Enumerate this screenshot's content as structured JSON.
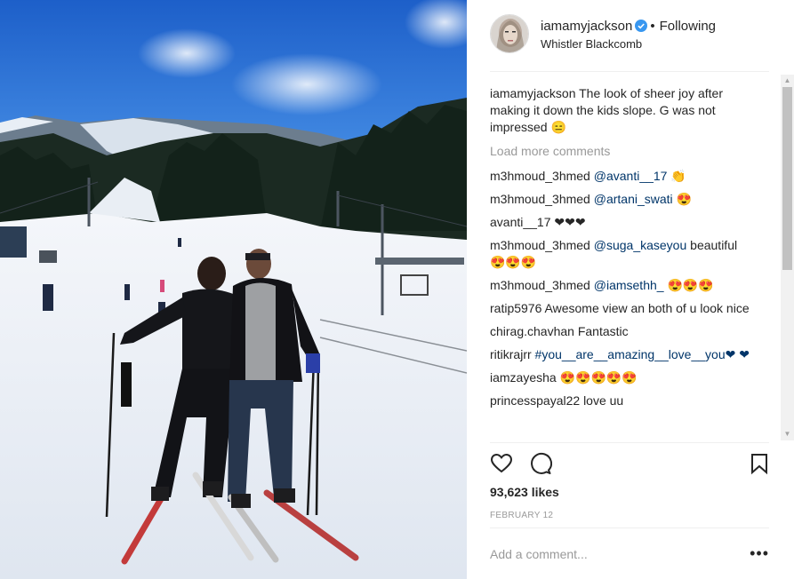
{
  "post": {
    "username": "iamamyjackson",
    "dot": "•",
    "follow_label": "Following",
    "location": "Whistler Blackcomb",
    "likes": "93,623 likes",
    "date": "FEBRUARY 12"
  },
  "caption": {
    "username": "iamamyjackson",
    "text": "The look of sheer joy after making it down the kids slope. G was not impressed 😑"
  },
  "load_more": "Load more comments",
  "comments": [
    {
      "user": "m3hmoud_3hmed",
      "tag": "@avanti__17",
      "text": " 👏"
    },
    {
      "user": "m3hmoud_3hmed",
      "tag": "@artani_swati",
      "text": " 😍"
    },
    {
      "user": "avanti__17",
      "tag": "",
      "text": "❤❤❤"
    },
    {
      "user": "m3hmoud_3hmed",
      "tag": "@suga_kaseyou",
      "text": " beautiful 😍😍😍"
    },
    {
      "user": "m3hmoud_3hmed",
      "tag": "@iamsethh_",
      "text": " 😍😍😍"
    },
    {
      "user": "ratip5976",
      "tag": "",
      "text": "Awesome view an both of u look nice"
    },
    {
      "user": "chirag.chavhan",
      "tag": "",
      "text": "Fantastic"
    },
    {
      "user": "ritikrajrr",
      "tag": "#you__are__amazing__love__you",
      "text": "❤ ❤"
    },
    {
      "user": "iamzayesha",
      "tag": "",
      "text": "😍😍😍😍😍"
    },
    {
      "user": "princesspayal22",
      "tag": "",
      "text": "love uu"
    }
  ],
  "add_comment": {
    "placeholder": "Add a comment..."
  },
  "more_label": "•••",
  "icons": {
    "verified": "verified-badge-icon",
    "like": "heart-icon",
    "comment": "comment-bubble-icon",
    "save": "bookmark-icon",
    "more": "more-options-icon"
  },
  "colors": {
    "verified": "#3897f0",
    "link": "#003569",
    "muted": "#999999",
    "text": "#262626"
  }
}
